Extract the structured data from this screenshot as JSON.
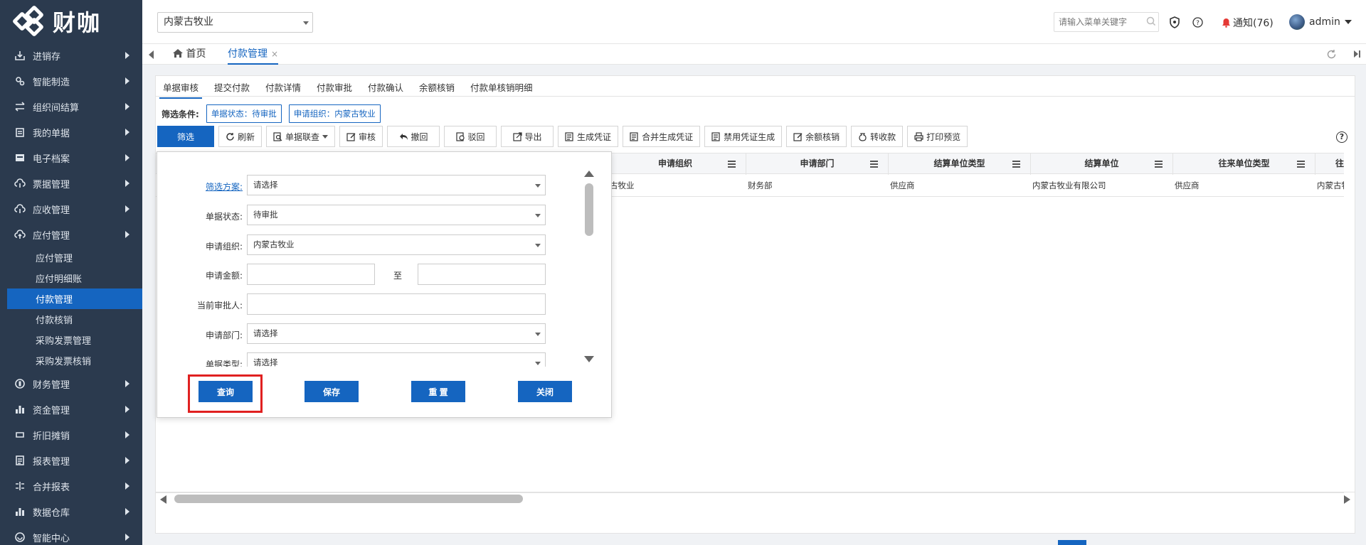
{
  "app": {
    "logo_text": "财咖"
  },
  "sidebar": {
    "items": [
      {
        "label": "进销存",
        "icon": "inventory-icon"
      },
      {
        "label": "智能制造",
        "icon": "gears-icon"
      },
      {
        "label": "组织间结算",
        "icon": "exchange-icon"
      },
      {
        "label": "我的单据",
        "icon": "clipboard-icon"
      },
      {
        "label": "电子档案",
        "icon": "archive-icon"
      },
      {
        "label": "票据管理",
        "icon": "cloud-icon"
      },
      {
        "label": "应收管理",
        "icon": "cloud-icon"
      },
      {
        "label": "应付管理",
        "icon": "cloud-upload-icon"
      }
    ],
    "sub_items": [
      "应付管理",
      "应付明细账",
      "付款管理",
      "付款核销",
      "采购发票管理",
      "采购发票核销"
    ],
    "items_after": [
      {
        "label": "财务管理",
        "icon": "coin-icon"
      },
      {
        "label": "资金管理",
        "icon": "bar-chart-icon"
      },
      {
        "label": "折旧摊销",
        "icon": "loop-icon"
      },
      {
        "label": "报表管理",
        "icon": "report-icon"
      },
      {
        "label": "合并报表",
        "icon": "merge-icon"
      },
      {
        "label": "数据仓库",
        "icon": "bar-chart-icon"
      },
      {
        "label": "智能中心",
        "icon": "globe-icon"
      }
    ]
  },
  "header": {
    "org": "内蒙古牧业",
    "search_placeholder": "请输入菜单关键字",
    "notify_label": "通知(76)",
    "user": "admin"
  },
  "tabs": {
    "home": "首页",
    "current": "付款管理",
    "close": "×"
  },
  "subtabs": [
    "单据审核",
    "提交付款",
    "付款详情",
    "付款审批",
    "付款确认",
    "余额核销",
    "付款单核销明细"
  ],
  "filter": {
    "label": "筛选条件:",
    "tags": [
      "单据状态：待审批",
      "申请组织：内蒙古牧业"
    ]
  },
  "toolbar": [
    "筛选",
    "刷新",
    "单据联查",
    "审核",
    "撤回",
    "驳回",
    "导出",
    "生成凭证",
    "合并生成凭证",
    "禁用凭证生成",
    "余额核销",
    "转收款",
    "打印预览"
  ],
  "grid": {
    "headers": [
      "申请组织",
      "申请部门",
      "结算单位类型",
      "结算单位",
      "往来单位类型",
      "往"
    ],
    "row": [
      "古牧业",
      "财务部",
      "供应商",
      "内蒙古牧业有限公司",
      "供应商",
      "内蒙古牧业"
    ]
  },
  "popup": {
    "fields": [
      {
        "label": "筛选方案:",
        "value": "请选择"
      },
      {
        "label": "单据状态:",
        "value": "待审批"
      },
      {
        "label": "申请组织:",
        "value": "内蒙古牧业"
      },
      {
        "label": "申请金额:",
        "to": "至"
      },
      {
        "label": "当前审批人:"
      },
      {
        "label": "申请部门:",
        "value": "请选择"
      },
      {
        "label": "单据类型:",
        "value": "请选择"
      }
    ],
    "buttons": [
      "查询",
      "保存",
      "重 置",
      "关闭"
    ]
  }
}
